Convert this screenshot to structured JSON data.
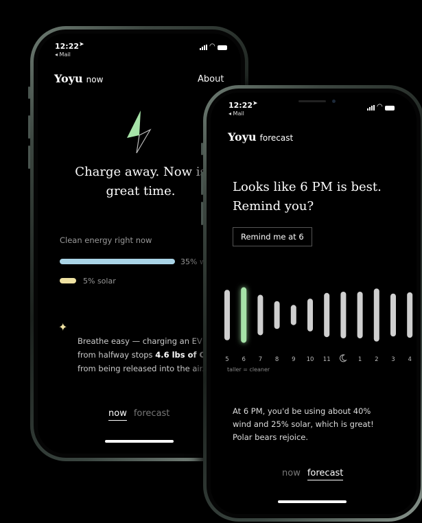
{
  "phone_left": {
    "status": {
      "time": "12:22",
      "back": "◂ Mail"
    },
    "brand": {
      "name": "Yoyu",
      "page": "now"
    },
    "about_label": "About",
    "headline": "Charge away. Now is great time.",
    "clean_energy": {
      "label": "Clean energy right now",
      "wind_percent_label": "35% w",
      "wind_level": 0.35,
      "solar_percent_label": "5% solar",
      "solar_level": 0.05,
      "colors": {
        "wind": "#a9d4e6",
        "solar": "#efe2a2"
      }
    },
    "tip": {
      "line1": "Breathe easy — charging an EV no",
      "line2_pre": "from halfway stops ",
      "line2_bold": "4.6 lbs of CO₂",
      "line3": "from being released into the air."
    },
    "nav": {
      "now": "now",
      "forecast": "forecast"
    }
  },
  "phone_right": {
    "status": {
      "time": "12:22",
      "back": "◂ Mail"
    },
    "brand": {
      "name": "Yoyu",
      "page": "forecast"
    },
    "headline": "Looks like 6 PM is best. Remind you?",
    "remind_button": "Remind me at 6",
    "chart_data": {
      "type": "bar",
      "categories": [
        "5",
        "6",
        "7",
        "8",
        "9",
        "10",
        "11",
        "moon",
        "1",
        "2",
        "3",
        "4"
      ],
      "values": [
        80,
        88,
        64,
        44,
        32,
        52,
        70,
        74,
        74,
        84,
        68,
        72
      ],
      "highlight_index": 1,
      "highlight_color": "#a6e3a8",
      "bar_color": "#cfcfcf",
      "caption": "taller = cleaner"
    },
    "summary": "At 6 PM, you'd be using about 40% wind and 25% solar, which is great! Polar bears rejoice.",
    "nav": {
      "now": "now",
      "forecast": "forecast"
    }
  }
}
